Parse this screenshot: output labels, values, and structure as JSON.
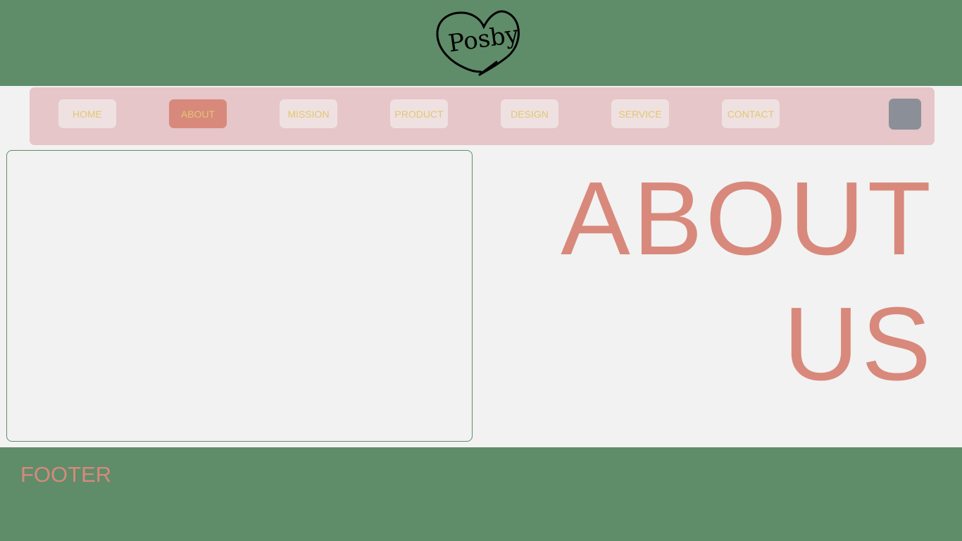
{
  "header": {
    "logo_text": "Posby"
  },
  "nav": {
    "items": [
      {
        "label": "HOME"
      },
      {
        "label": "ABOUT"
      },
      {
        "label": "MISSION"
      },
      {
        "label": "PRODUCT"
      },
      {
        "label": "DESIGN"
      },
      {
        "label": "SERVICE"
      },
      {
        "label": "CONTACT"
      }
    ],
    "active": "ABOUT"
  },
  "main": {
    "title_line1": "ABOUT",
    "title_line2": "US"
  },
  "footer": {
    "label": "FOOTER"
  },
  "colors": {
    "header_bg": "#5f8c69",
    "nav_bg": "#e6c6c8",
    "nav_item_bg": "#efe1e1",
    "nav_active_bg": "#d8897b",
    "nav_text": "#e2c773",
    "accent": "#d8897b",
    "square_button": "#8b9098"
  }
}
